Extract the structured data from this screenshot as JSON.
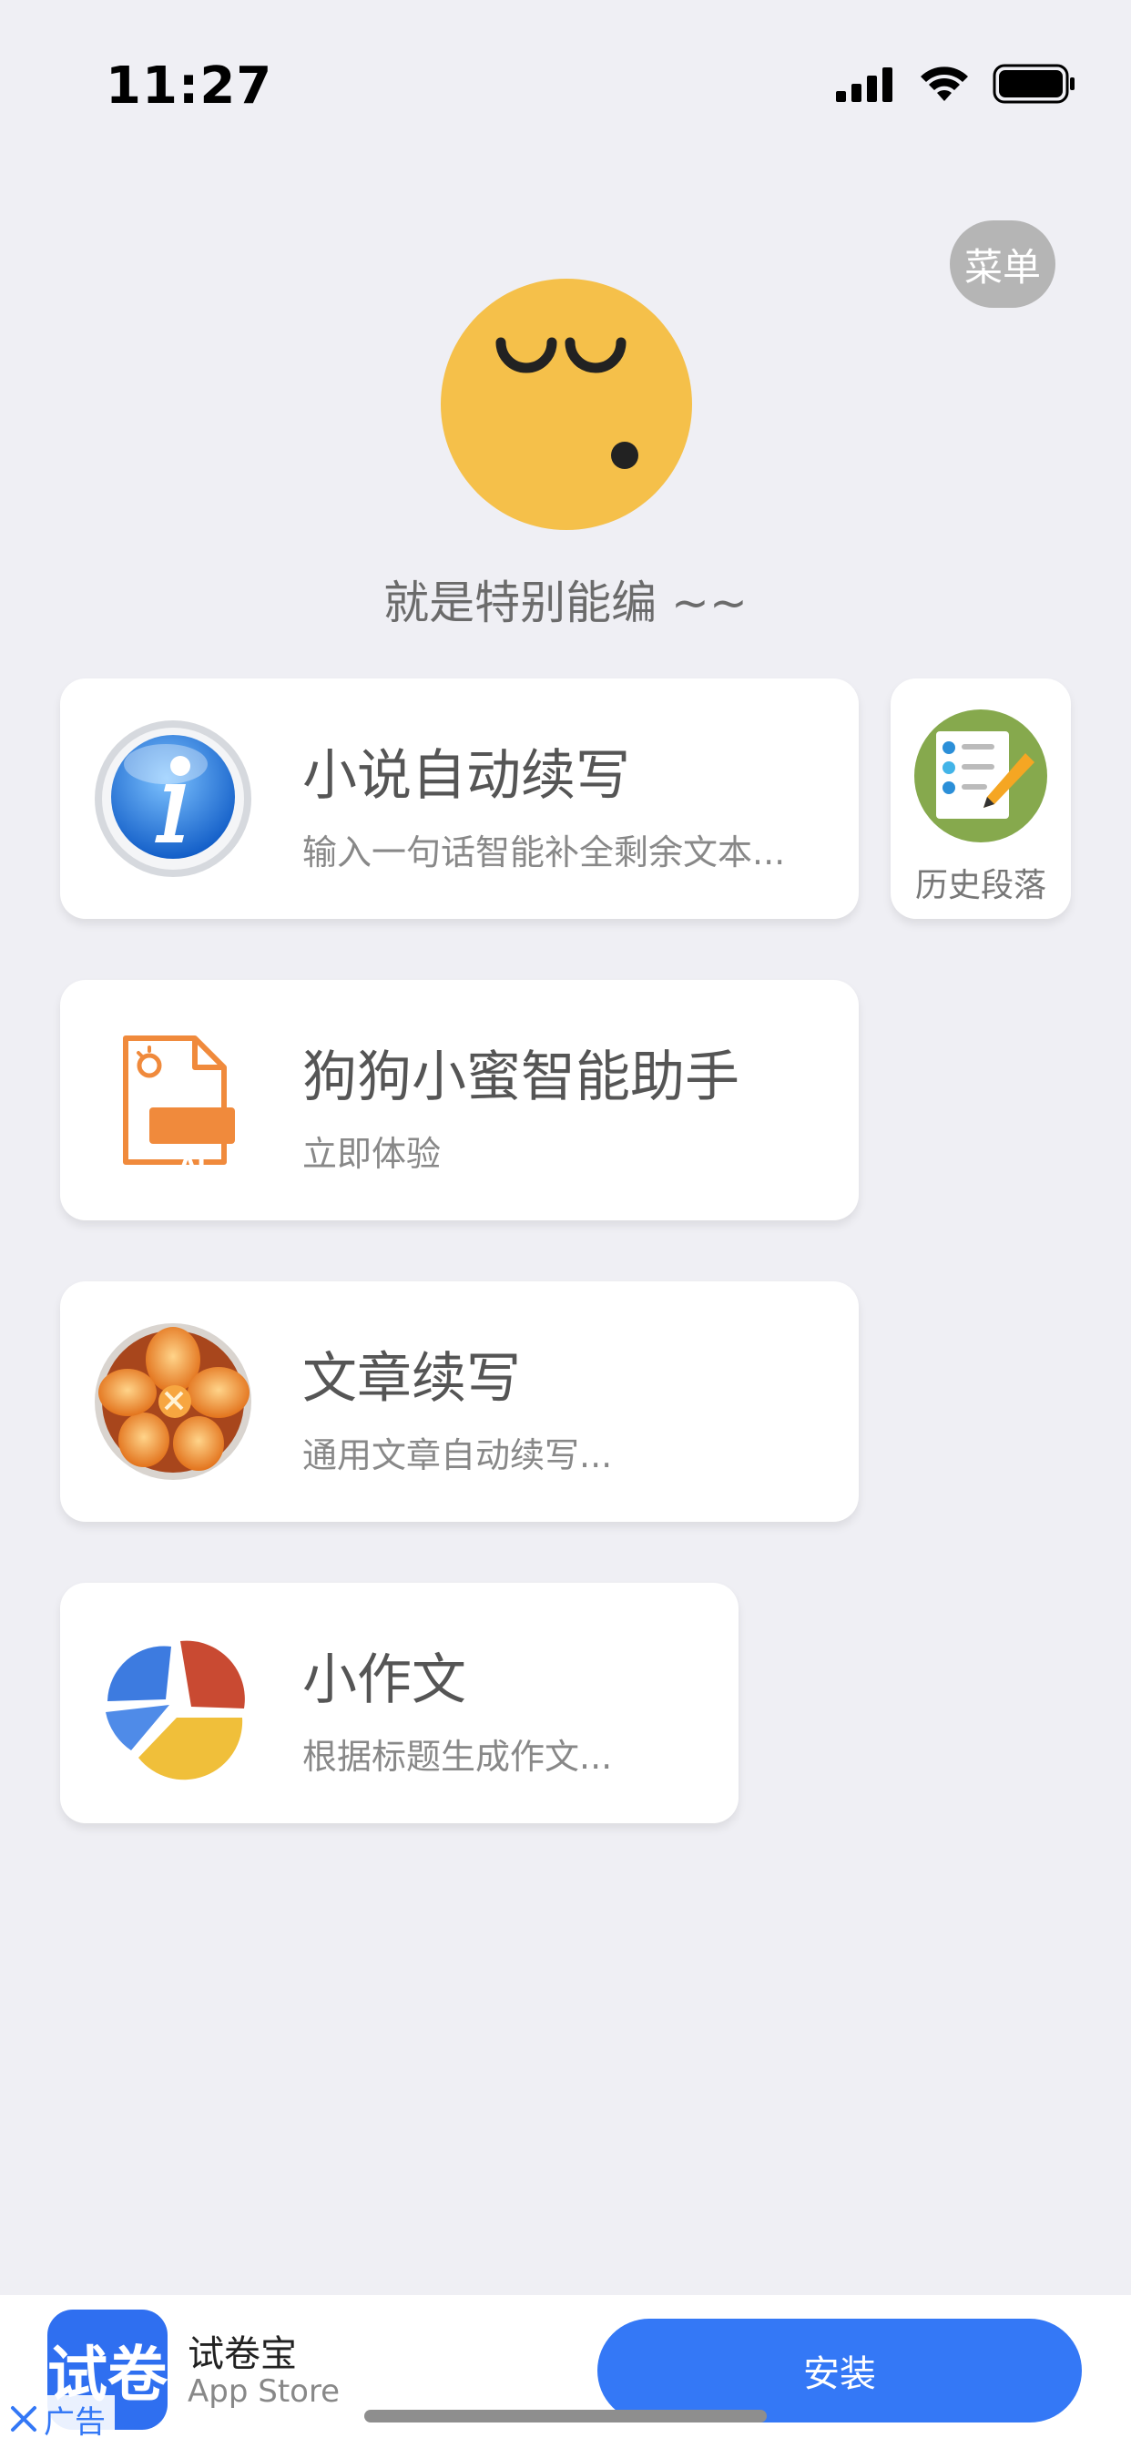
{
  "status_bar": {
    "time": "11:27"
  },
  "header": {
    "menu_label": "菜单",
    "slogan": "就是特别能编 ~~"
  },
  "cards": [
    {
      "title": "小说自动续写",
      "subtitle": "输入一句话智能补全剩余文本..."
    },
    {
      "title": "狗狗小蜜智能助手",
      "subtitle": "立即体验",
      "icon_text": "AI"
    },
    {
      "title": "文章续写",
      "subtitle": "通用文章自动续写..."
    },
    {
      "title": "小作文",
      "subtitle": "根据标题生成作文..."
    }
  ],
  "history": {
    "label": "历史段落"
  },
  "ad": {
    "icon_text": "试卷",
    "app_name": "试卷宝",
    "store": "App Store",
    "install_label": "安装",
    "tag_label": "广告"
  },
  "colors": {
    "background": "#efeff4",
    "face": "#f5c04a",
    "accent": "#3478f6",
    "menu_button": "#b5b5b5"
  }
}
